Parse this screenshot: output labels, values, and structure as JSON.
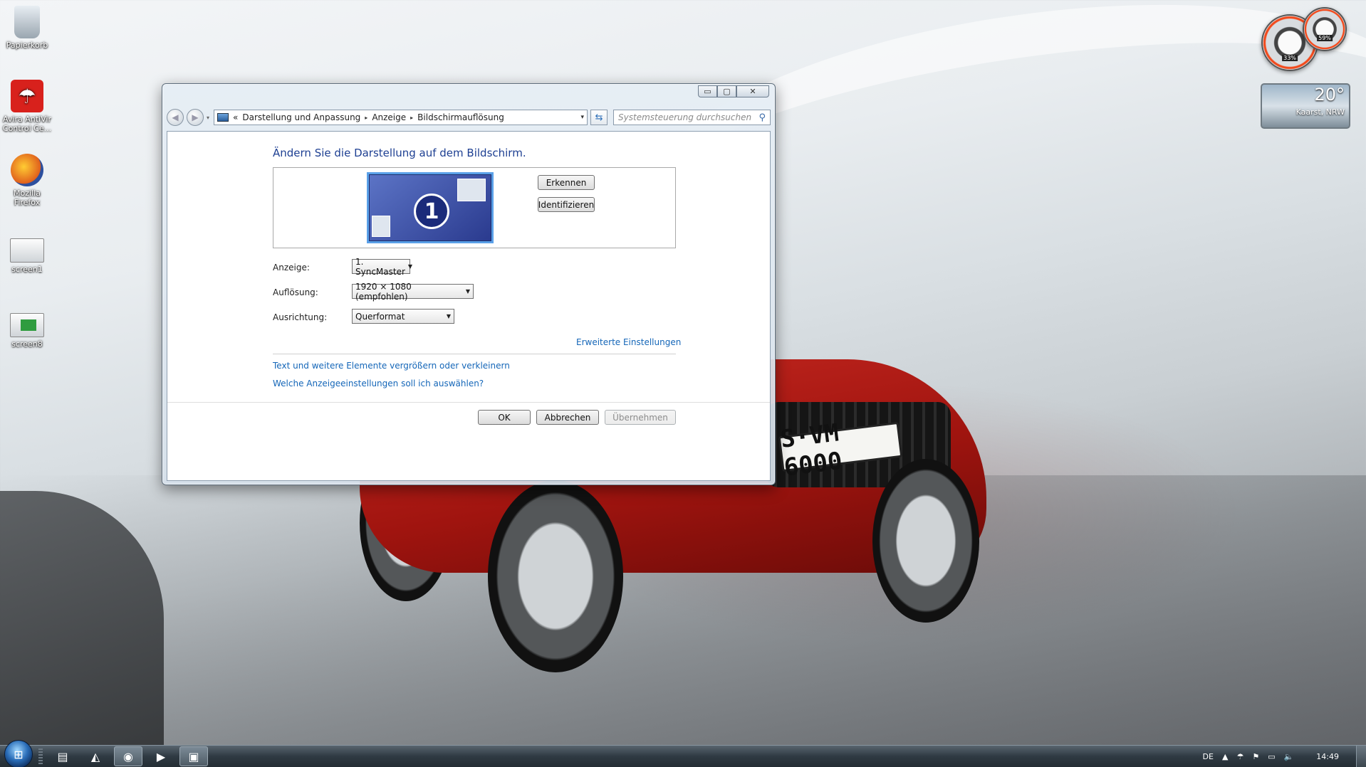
{
  "desktop": {
    "icons": [
      {
        "label": "Papierkorb",
        "icon": "recycle-bin-icon"
      },
      {
        "label": "Avira AntiVir Control Ce...",
        "icon": "avira-icon"
      },
      {
        "label": "Mozilla Firefox",
        "icon": "firefox-icon"
      },
      {
        "label": "screen1",
        "icon": "image-file-icon"
      },
      {
        "label": "screen8",
        "icon": "image-file-icon"
      }
    ],
    "gadgets": {
      "cpu_percent": "33%",
      "memory_percent": "59%",
      "weather_temp": "20°",
      "weather_location": "Kaarst, NRW"
    },
    "license_plate": "S·VM 6000"
  },
  "window": {
    "caption_buttons": {
      "minimize": "▭",
      "maximize": "▢",
      "close": "✕"
    },
    "breadcrumb": {
      "prefix": "«",
      "items": [
        "Darstellung und Anpassung",
        "Anzeige",
        "Bildschirmauflösung"
      ],
      "separator": "▸",
      "dropdown": "▾"
    },
    "search_placeholder": "Systemsteuerung durchsuchen",
    "heading": "Ändern Sie die Darstellung auf dem Bildschirm.",
    "monitor_number": "1",
    "buttons": {
      "detect": "Erkennen",
      "identify": "Identifizieren",
      "ok": "OK",
      "cancel": "Abbrechen",
      "apply": "Übernehmen"
    },
    "fields": {
      "display_label": "Anzeige:",
      "display_value": "1. SyncMaster",
      "resolution_label": "Auflösung:",
      "resolution_value": "1920 × 1080 (empfohlen)",
      "orientation_label": "Ausrichtung:",
      "orientation_value": "Querformat"
    },
    "links": {
      "advanced": "Erweiterte Einstellungen",
      "text_size": "Text und weitere Elemente vergrößern oder verkleinern",
      "which_settings": "Welche Anzeigeeinstellungen soll ich auswählen?"
    }
  },
  "taskbar": {
    "language": "DE",
    "clock": "14:49"
  },
  "colors": {
    "heading": "#1d3f92",
    "link": "#1466b8",
    "monitor_fill": "#2a3a8e",
    "taskbar": "#2f3a43"
  }
}
